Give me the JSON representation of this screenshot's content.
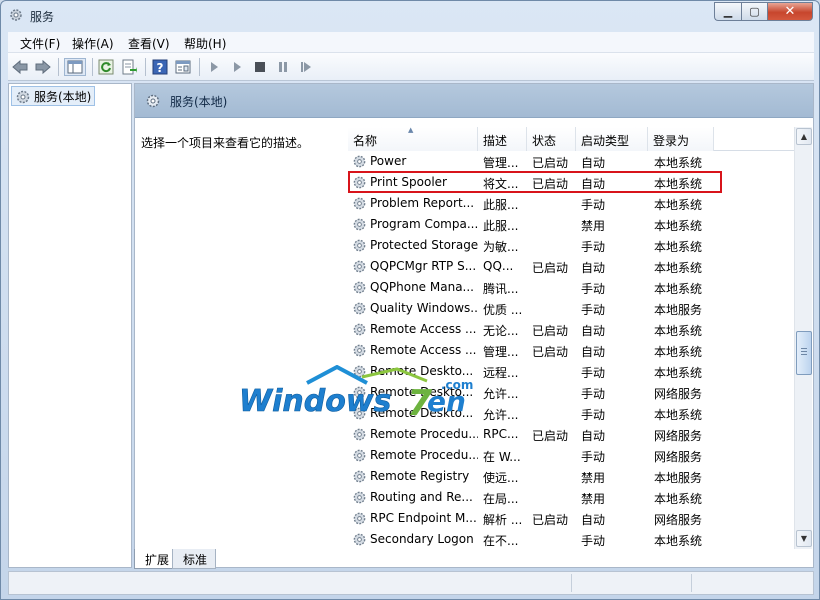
{
  "window": {
    "title": "服务",
    "controls": {
      "minimize": "▁",
      "maximize": "▢",
      "close": "✕"
    }
  },
  "menu": {
    "items": [
      "文件(F)",
      "操作(A)",
      "查看(V)",
      "帮助(H)"
    ]
  },
  "toolbar": {
    "icons": [
      "back-arrow-icon",
      "forward-arrow-icon",
      "show-hide-tree-icon",
      "refresh-icon",
      "export-list-icon",
      "help-icon",
      "properties-icon",
      "start-service-icon",
      "start-service-2-icon",
      "stop-service-icon",
      "pause-service-icon",
      "restart-service-icon"
    ]
  },
  "tree": {
    "root_label": "服务(本地)"
  },
  "main": {
    "header_title": "服务(本地)",
    "description_prompt": "选择一个项目来查看它的描述。",
    "columns": [
      "名称",
      "描述",
      "状态",
      "启动类型",
      "登录为"
    ],
    "rows": [
      {
        "name": "Power",
        "desc": "管理...",
        "status": "已启动",
        "startup": "自动",
        "logon": "本地系统"
      },
      {
        "name": "Print Spooler",
        "desc": "将文...",
        "status": "已启动",
        "startup": "自动",
        "logon": "本地系统"
      },
      {
        "name": "Problem Report...",
        "desc": "此服...",
        "status": "",
        "startup": "手动",
        "logon": "本地系统"
      },
      {
        "name": "Program Compa...",
        "desc": "此服...",
        "status": "",
        "startup": "禁用",
        "logon": "本地系统"
      },
      {
        "name": "Protected Storage",
        "desc": "为敏...",
        "status": "",
        "startup": "手动",
        "logon": "本地系统"
      },
      {
        "name": "QQPCMgr RTP S...",
        "desc": "QQ...",
        "status": "已启动",
        "startup": "自动",
        "logon": "本地系统"
      },
      {
        "name": "QQPhone Mana...",
        "desc": "腾讯...",
        "status": "",
        "startup": "手动",
        "logon": "本地系统"
      },
      {
        "name": "Quality Windows...",
        "desc": "优质 ...",
        "status": "",
        "startup": "手动",
        "logon": "本地服务"
      },
      {
        "name": "Remote Access ...",
        "desc": "无论...",
        "status": "已启动",
        "startup": "自动",
        "logon": "本地系统"
      },
      {
        "name": "Remote Access ...",
        "desc": "管理...",
        "status": "已启动",
        "startup": "自动",
        "logon": "本地系统"
      },
      {
        "name": "Remote Deskto...",
        "desc": "远程...",
        "status": "",
        "startup": "手动",
        "logon": "本地系统"
      },
      {
        "name": "Remote Deskto...",
        "desc": "允许...",
        "status": "",
        "startup": "手动",
        "logon": "网络服务"
      },
      {
        "name": "Remote Deskto...",
        "desc": "允许...",
        "status": "",
        "startup": "手动",
        "logon": "本地系统"
      },
      {
        "name": "Remote Procedu...",
        "desc": "RPC...",
        "status": "已启动",
        "startup": "自动",
        "logon": "网络服务"
      },
      {
        "name": "Remote Procedu...",
        "desc": "在 W...",
        "status": "",
        "startup": "手动",
        "logon": "网络服务"
      },
      {
        "name": "Remote Registry",
        "desc": "使远...",
        "status": "",
        "startup": "禁用",
        "logon": "本地服务"
      },
      {
        "name": "Routing and Re...",
        "desc": "在局...",
        "status": "",
        "startup": "禁用",
        "logon": "本地系统"
      },
      {
        "name": "RPC Endpoint M...",
        "desc": "解析 ...",
        "status": "已启动",
        "startup": "自动",
        "logon": "网络服务"
      },
      {
        "name": "Secondary Logon",
        "desc": "在不...",
        "status": "",
        "startup": "手动",
        "logon": "本地系统"
      }
    ]
  },
  "tabs": [
    "扩展",
    "标准"
  ],
  "watermark": {
    "text": "Windows7en",
    "suffix": ".com"
  },
  "colors": {
    "highlight_border": "#d8141b",
    "header_bg": "#a9bfd6"
  }
}
